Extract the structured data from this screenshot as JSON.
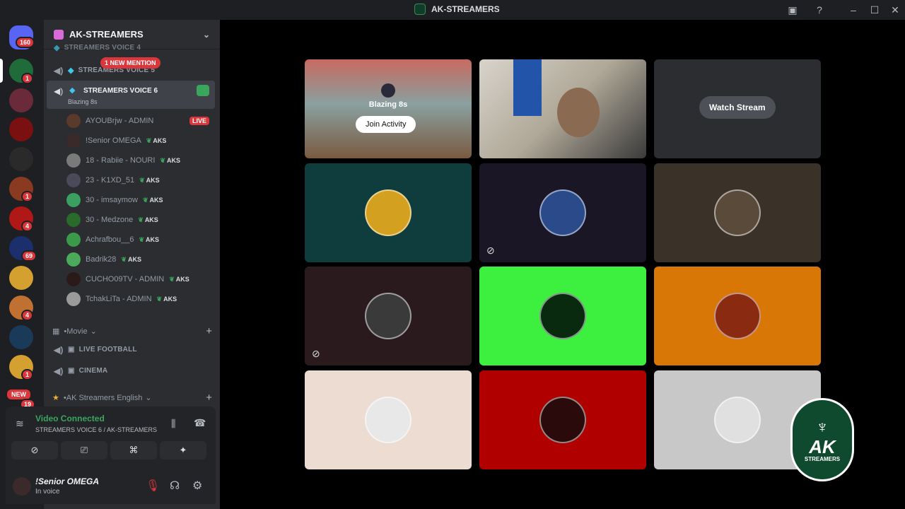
{
  "titlebar": {
    "title": "AK-STREAMERS"
  },
  "servers": {
    "home_badge": "160",
    "items": [
      {
        "badge": "1",
        "color": "#1f6b3a"
      },
      {
        "badge": "",
        "color": "#6b2a3a"
      },
      {
        "badge": "",
        "color": "#7a1010"
      },
      {
        "badge": "",
        "color": "#2a2a2a"
      },
      {
        "badge": "1",
        "color": "#8a3a20"
      },
      {
        "badge": "4",
        "color": "#b01818"
      },
      {
        "badge": "69",
        "color": "#1a2f6b"
      },
      {
        "badge": "",
        "color": "#d4a030"
      },
      {
        "badge": "4",
        "color": "#c07030"
      },
      {
        "badge": "",
        "color": "#1a3a5a"
      },
      {
        "badge": "1",
        "color": "#d4a030"
      }
    ],
    "new_label": "NEW",
    "new_badge": "19"
  },
  "guild": {
    "name": "AK-STREAMERS"
  },
  "channels": {
    "partial_top": "STREAMERS VOICE 4",
    "voice5": "STREAMERS VOICE 5",
    "mention": "1 NEW MENTION",
    "voice6": "STREAMERS VOICE 6",
    "voice6_activity": "Blazing 8s",
    "users": [
      {
        "name": "AYOUBrjw - ADMIN",
        "tag": "",
        "live": "LIVE",
        "color": "#5a3a2a"
      },
      {
        "name": "!Senior OMEGA",
        "tag": "AKS",
        "live": "",
        "color": "#3a2a2a"
      },
      {
        "name": "18 - Rabiie - NOURI",
        "tag": "AKS",
        "live": "",
        "color": "#7a7a7a"
      },
      {
        "name": "23 - K1XD_51",
        "tag": "AKS",
        "live": "",
        "color": "#4a4a5a"
      },
      {
        "name": "30 - imsaymow",
        "tag": "AKS",
        "live": "",
        "color": "#3aa060"
      },
      {
        "name": "30 - Medzone",
        "tag": "AKS",
        "live": "",
        "color": "#2a6a2a"
      },
      {
        "name": "Achrafbou__6",
        "tag": "AKS",
        "live": "",
        "color": "#3a9a4a"
      },
      {
        "name": "Badrik28",
        "tag": "AKS",
        "live": "",
        "color": "#4aaa5a"
      },
      {
        "name": "CUCHO09TV - ADMIN",
        "tag": "AKS",
        "live": "",
        "color": "#2a1a1a"
      },
      {
        "name": "TchakLiTa - ADMIN",
        "tag": "AKS",
        "live": "",
        "color": "#9a9a9a"
      }
    ],
    "cat_movie": "Movie",
    "live_football": "LIVE FOOTBALL",
    "cinema": "CINEMA",
    "cat_english": "AK Streamers English"
  },
  "voice_panel": {
    "title": "Video Connected",
    "subtitle": "STREAMERS VOICE 6 / AK-STREAMERS"
  },
  "userbar": {
    "name": "!Senior OMEGA",
    "status": "In voice"
  },
  "stage": {
    "activity_name": "Blazing 8s",
    "join_label": "Join Activity",
    "watch_label": "Watch Stream",
    "tiles": [
      {
        "bg": "#0f3d3d",
        "av": "#d4a020",
        "muted": false
      },
      {
        "bg": "#1a1626",
        "av": "#2a4a8a",
        "muted": true
      },
      {
        "bg": "#3a3128",
        "av": "#5a4a3a",
        "muted": false
      },
      {
        "bg": "#2a1a1e",
        "av": "#3a3a3a",
        "muted": true
      },
      {
        "bg": "#3df040",
        "av": "#0a2a10",
        "muted": false
      },
      {
        "bg": "#d97706",
        "av": "#8a2a10",
        "muted": false
      },
      {
        "bg": "#ecdcd2",
        "av": "#e8e8e8",
        "muted": false
      },
      {
        "bg": "#b00000",
        "av": "#2a0a0a",
        "muted": false
      },
      {
        "bg": "#c8c8c8",
        "av": "#e0e0e0",
        "muted": false
      }
    ]
  },
  "logo": {
    "big": "AK",
    "small": "STREAMERS"
  }
}
